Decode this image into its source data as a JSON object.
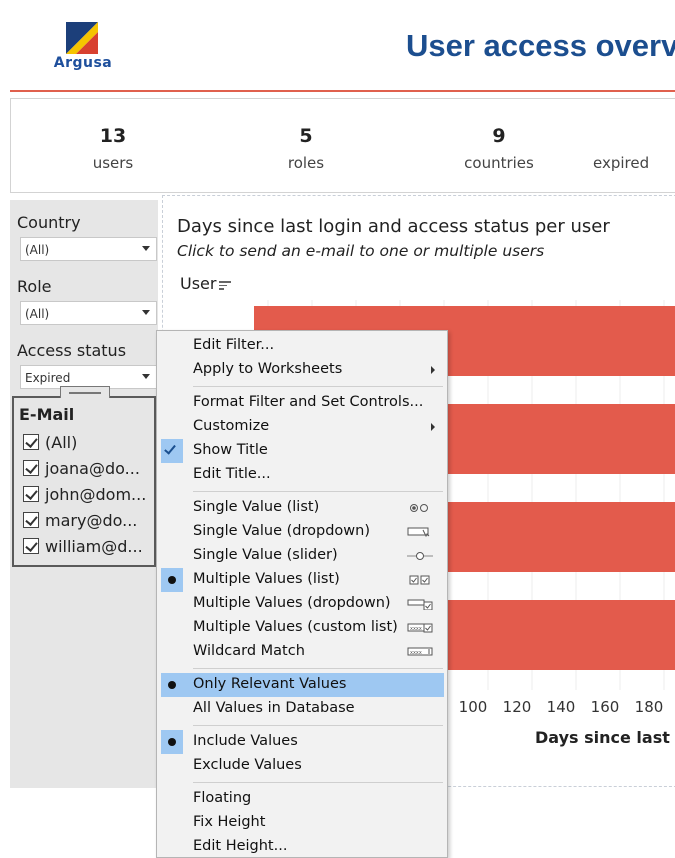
{
  "header": {
    "logo_text": "Argusa",
    "page_title": "User access overv",
    "colors": {
      "brand_blue": "#1c4e8f",
      "accent_red": "#e0604d",
      "logo_yellow": "#f5c400"
    }
  },
  "kpis": [
    {
      "value": "13",
      "label": "users"
    },
    {
      "value": "5",
      "label": "roles"
    },
    {
      "value": "9",
      "label": "countries"
    },
    {
      "value": "",
      "label": "expired"
    }
  ],
  "filters": {
    "country": {
      "label": "Country",
      "value": "(All)"
    },
    "role": {
      "label": "Role",
      "value": "(All)"
    },
    "access_status": {
      "label": "Access status",
      "value": "Expired"
    },
    "email": {
      "label": "E-Mail",
      "items": [
        {
          "label": "(All)",
          "checked": true
        },
        {
          "label": "joana@do...",
          "checked": true
        },
        {
          "label": "john@dom...",
          "checked": true
        },
        {
          "label": "mary@do...",
          "checked": true
        },
        {
          "label": "william@d...",
          "checked": true
        }
      ]
    }
  },
  "worksheet": {
    "title": "Days since last login and access status per user",
    "subtitle": "Click to send an e-mail to one or multiple users",
    "row_header": "User",
    "x_title": "Days since last log"
  },
  "chart_data": {
    "type": "bar",
    "orientation": "horizontal",
    "bar_color": "#e35b4c",
    "categories": [
      "",
      "",
      "",
      ""
    ],
    "values": [
      null,
      null,
      null,
      null
    ],
    "x_tick_labels": [
      "100",
      "120",
      "140",
      "160",
      "180"
    ],
    "xlabel": "Days since last log",
    "ylabel": "User"
  },
  "context_menu": {
    "items": [
      {
        "label": "Edit Filter...",
        "mark": "",
        "submenu": false,
        "highlight": false,
        "icon": ""
      },
      {
        "label": "Apply to Worksheets",
        "mark": "",
        "submenu": true,
        "highlight": false,
        "icon": ""
      },
      {
        "separator": true
      },
      {
        "label": "Format Filter and Set Controls...",
        "mark": "",
        "submenu": false,
        "highlight": false,
        "icon": ""
      },
      {
        "label": "Customize",
        "mark": "",
        "submenu": true,
        "highlight": false,
        "icon": ""
      },
      {
        "label": "Show Title",
        "mark": "check",
        "submenu": false,
        "highlight": false,
        "icon": ""
      },
      {
        "label": "Edit Title...",
        "mark": "",
        "submenu": false,
        "highlight": false,
        "icon": ""
      },
      {
        "separator": true
      },
      {
        "label": "Single Value (list)",
        "mark": "",
        "submenu": false,
        "highlight": false,
        "icon": "radio-list-icon"
      },
      {
        "label": "Single Value (dropdown)",
        "mark": "",
        "submenu": false,
        "highlight": false,
        "icon": "dropdown-icon"
      },
      {
        "label": "Single Value (slider)",
        "mark": "",
        "submenu": false,
        "highlight": false,
        "icon": "slider-icon"
      },
      {
        "label": "Multiple Values (list)",
        "mark": "dot",
        "submenu": false,
        "highlight": false,
        "icon": "checkbox-list-icon"
      },
      {
        "label": "Multiple Values (dropdown)",
        "mark": "",
        "submenu": false,
        "highlight": false,
        "icon": "dropdown-check-icon"
      },
      {
        "label": "Multiple Values (custom list)",
        "mark": "",
        "submenu": false,
        "highlight": false,
        "icon": "custom-list-icon"
      },
      {
        "label": "Wildcard Match",
        "mark": "",
        "submenu": false,
        "highlight": false,
        "icon": "wildcard-icon"
      },
      {
        "separator": true
      },
      {
        "label": "Only Relevant Values",
        "mark": "dot",
        "submenu": false,
        "highlight": true,
        "icon": ""
      },
      {
        "label": "All Values in Database",
        "mark": "",
        "submenu": false,
        "highlight": false,
        "icon": ""
      },
      {
        "separator": true
      },
      {
        "label": "Include Values",
        "mark": "dot",
        "submenu": false,
        "highlight": false,
        "icon": ""
      },
      {
        "label": "Exclude Values",
        "mark": "",
        "submenu": false,
        "highlight": false,
        "icon": ""
      },
      {
        "separator": true
      },
      {
        "label": "Floating",
        "mark": "",
        "submenu": false,
        "highlight": false,
        "icon": ""
      },
      {
        "label": "Fix Height",
        "mark": "",
        "submenu": false,
        "highlight": false,
        "icon": ""
      },
      {
        "label": "Edit Height...",
        "mark": "",
        "submenu": false,
        "highlight": false,
        "icon": ""
      }
    ]
  }
}
